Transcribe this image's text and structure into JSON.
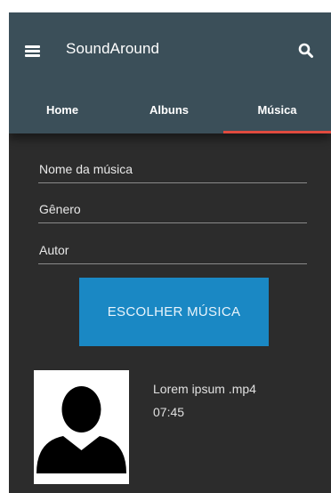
{
  "app": {
    "title": "SoundAround"
  },
  "header": {
    "menu_icon": "menu-icon",
    "search_icon": "search-icon"
  },
  "tabs": [
    {
      "label": "Home",
      "active": false
    },
    {
      "label": "Albuns",
      "active": false
    },
    {
      "label": "Música",
      "active": true
    }
  ],
  "form": {
    "fields": [
      {
        "placeholder": "Nome da música",
        "value": ""
      },
      {
        "placeholder": "Gênero",
        "value": ""
      },
      {
        "placeholder": "Autor",
        "value": ""
      }
    ],
    "choose_button": "ESCOLHER MÚSICA"
  },
  "selected_file": {
    "name": "Lorem ipsum .mp4",
    "duration": "07:45",
    "thumbnail_icon": "person-icon"
  },
  "colors": {
    "appbar": "#3b4f59",
    "background": "#2c2c2c",
    "tab_indicator": "#e04b3f",
    "button": "#1a88c4"
  }
}
